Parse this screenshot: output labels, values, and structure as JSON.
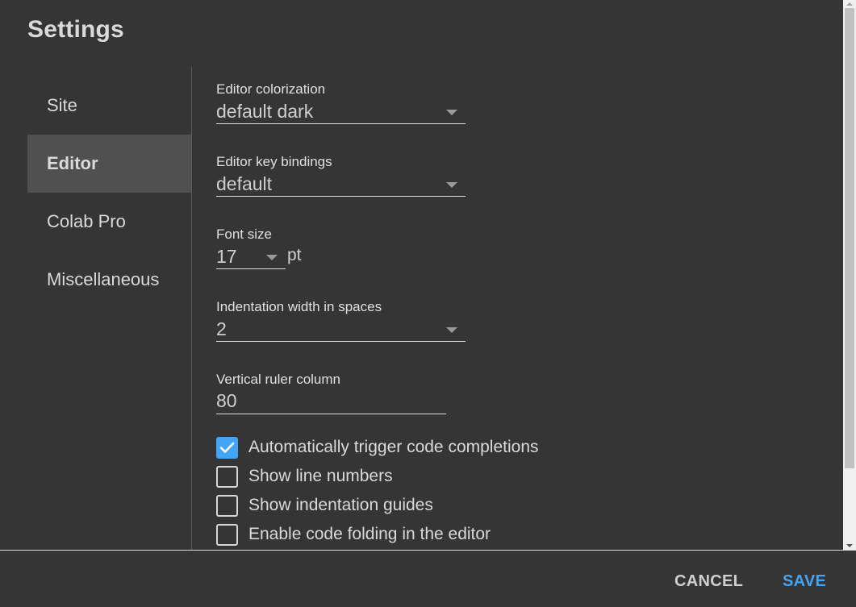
{
  "dialog": {
    "title": "Settings"
  },
  "sidebar": {
    "items": [
      {
        "label": "Site",
        "active": false
      },
      {
        "label": "Editor",
        "active": true
      },
      {
        "label": "Colab Pro",
        "active": false
      },
      {
        "label": "Miscellaneous",
        "active": false
      }
    ]
  },
  "editor": {
    "colorization": {
      "label": "Editor colorization",
      "value": "default dark"
    },
    "key_bindings": {
      "label": "Editor key bindings",
      "value": "default"
    },
    "font_size": {
      "label": "Font size",
      "value": "17",
      "unit": "pt"
    },
    "indentation": {
      "label": "Indentation width in spaces",
      "value": "2"
    },
    "vertical_ruler": {
      "label": "Vertical ruler column",
      "value": "80"
    },
    "checkboxes": [
      {
        "label": "Automatically trigger code completions",
        "checked": true
      },
      {
        "label": "Show line numbers",
        "checked": false
      },
      {
        "label": "Show indentation guides",
        "checked": false
      },
      {
        "label": "Enable code folding in the editor",
        "checked": false
      }
    ]
  },
  "footer": {
    "cancel_label": "CANCEL",
    "save_label": "SAVE"
  },
  "colors": {
    "accent": "#42a5f5",
    "background": "#353535",
    "active_item": "#505050"
  }
}
